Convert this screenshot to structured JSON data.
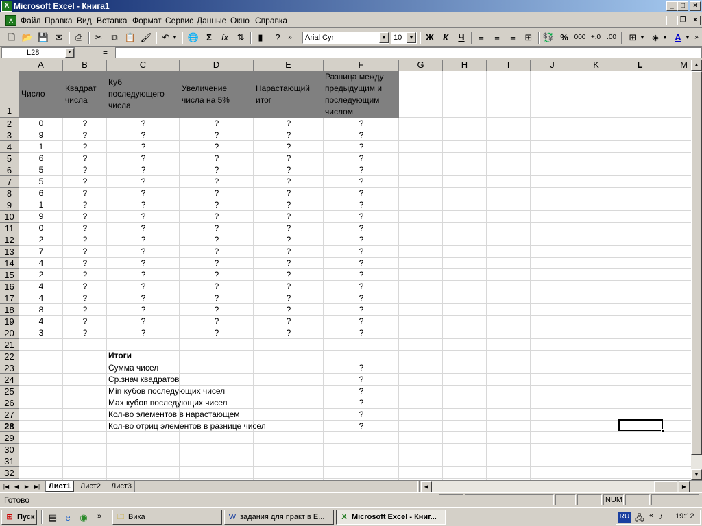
{
  "window": {
    "title": "Microsoft Excel - Книга1"
  },
  "menu": [
    "Файл",
    "Правка",
    "Вид",
    "Вставка",
    "Формат",
    "Сервис",
    "Данные",
    "Окно",
    "Справка"
  ],
  "toolbar": {
    "font": "Arial Cyr",
    "size": "10",
    "bold": "Ж",
    "italic": "К",
    "underline": "Ч",
    "percent": "%",
    "thousands": "000",
    "sigma": "Σ",
    "fx": "fx"
  },
  "formula": {
    "cell_ref": "L28",
    "eq": "=",
    "value": ""
  },
  "columns": [
    "A",
    "B",
    "C",
    "D",
    "E",
    "F",
    "G",
    "H",
    "I",
    "J",
    "K",
    "L",
    "M"
  ],
  "rows": [
    "1",
    "2",
    "3",
    "4",
    "5",
    "6",
    "7",
    "8",
    "9",
    "10",
    "11",
    "12",
    "13",
    "14",
    "15",
    "16",
    "17",
    "18",
    "19",
    "20",
    "21",
    "22",
    "23",
    "24",
    "25",
    "26",
    "27",
    "28",
    "29",
    "30",
    "31",
    "32"
  ],
  "header": {
    "a": "Число",
    "b": [
      "Квадрат",
      "числа"
    ],
    "c": [
      "Куб",
      "последующего",
      "числа"
    ],
    "d": [
      "Увеличение",
      "числа на 5%"
    ],
    "e": [
      "Нарастающий",
      "итог"
    ],
    "f": [
      "Разница между",
      "предыдущим и",
      "последующим",
      "числом"
    ]
  },
  "numbers": [
    "0",
    "9",
    "1",
    "6",
    "5",
    "5",
    "6",
    "1",
    "9",
    "0",
    "2",
    "7",
    "4",
    "2",
    "4",
    "4",
    "8",
    "4",
    "3"
  ],
  "placeholder": "?",
  "totals": {
    "title": "Итоги",
    "items": [
      "Сумма чисел",
      "Ср.знач квадратов",
      "Min кубов последующих чисел",
      "Max кубов последующих чисел",
      "Кол-во элементов в нарастающем",
      "Кол-во отриц элементов в разнице чисел"
    ],
    "value": "?"
  },
  "sheets": [
    "Лист1",
    "Лист2",
    "Лист3"
  ],
  "status": {
    "text": "Готово",
    "num": "NUM"
  },
  "taskbar": {
    "start": "Пуск",
    "tasks": [
      "Вика",
      "задания для практ в Е...",
      "Microsoft Excel - Книг..."
    ],
    "lang": "RU",
    "time": "19:12"
  }
}
